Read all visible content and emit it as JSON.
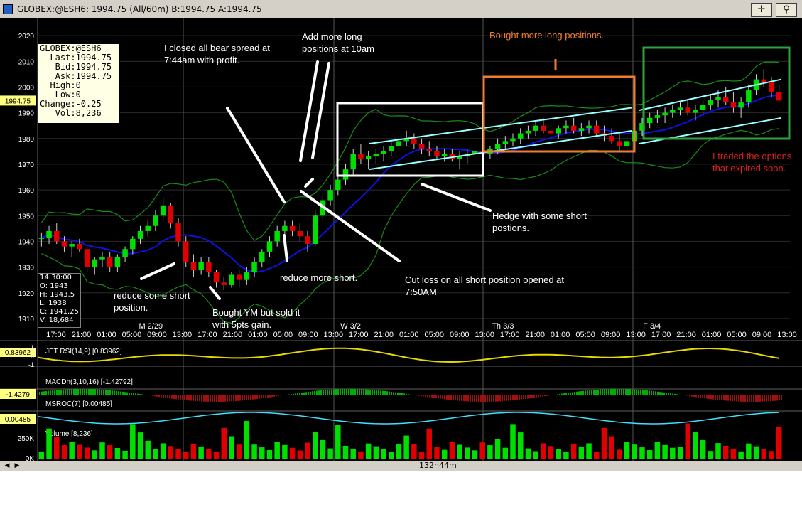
{
  "window": {
    "title": "GLOBEX:@ESH6: 1994.75 (All/60m)  B:1994.75  A:1994.75",
    "buttons": [
      "✛",
      "⚲"
    ]
  },
  "quote_box": {
    "rows": [
      "GLOBEX:@ESH6",
      "  Last:1994.75",
      "   Bid:1994.75",
      "   Ask:1994.75",
      "  High:0",
      "   Low:0",
      "Change:-0.25",
      "   Vol:8,236"
    ]
  },
  "bar_info": {
    "rows": [
      "14:30:00",
      "O: 1943",
      "H: 1943.5",
      "L: 1938",
      "C: 1941.25",
      "V: 18,684"
    ]
  },
  "price_marker": "1994.75",
  "annotations": [
    {
      "id": "closed-bear-spread",
      "lines": [
        "I closed all bear spread at",
        "7:44am with profit."
      ],
      "color": "#ffffff"
    },
    {
      "id": "add-long",
      "lines": [
        "Add more long",
        "positions at 10am"
      ],
      "color": "#ffffff"
    },
    {
      "id": "bought-more-long",
      "lines": [
        "Bought more long positions."
      ],
      "color": "#f07c30"
    },
    {
      "id": "traded-options",
      "lines": [
        "I traded the options",
        "that expired soon."
      ],
      "color": "#e02020"
    },
    {
      "id": "hedge-short",
      "lines": [
        "Hedge with some short",
        "postions."
      ],
      "color": "#ffffff"
    },
    {
      "id": "cut-loss",
      "lines": [
        "Cut loss on all short position opened at",
        "7:50AM"
      ],
      "color": "#ffffff"
    },
    {
      "id": "reduce-more-short",
      "lines": [
        "reduce more short."
      ],
      "color": "#ffffff"
    },
    {
      "id": "reduce-some-short",
      "lines": [
        "reduce some short",
        "position."
      ],
      "color": "#ffffff"
    },
    {
      "id": "bought-ym",
      "lines": [
        "Bought YM but sold it",
        "with 5pts gain."
      ],
      "color": "#ffffff"
    }
  ],
  "chart_data": {
    "type": "candlestick",
    "instrument": "GLOBEX:@ESH6",
    "interval": "60m",
    "price_axis": {
      "ticks": [
        2020,
        2010,
        2000,
        1990,
        1980,
        1970,
        1960,
        1950,
        1940,
        1930,
        1920,
        1910
      ],
      "ylim": [
        1905,
        2025
      ]
    },
    "time_labels": [
      "17:00",
      "21:00",
      "01:00",
      "05:00",
      "09:00",
      "13:00",
      "17:00",
      "21:00",
      "01:00",
      "05:00",
      "09:00",
      "13:00",
      "17:00",
      "21:00",
      "01:00",
      "05:00",
      "09:00",
      "13:00",
      "17:00",
      "21:00",
      "01:00",
      "05:00",
      "09:00",
      "13:00",
      "17:00",
      "21:00",
      "01:00",
      "05:00",
      "09:00",
      "13:00"
    ],
    "day_labels": [
      {
        "label": "M  2/29",
        "at": 3
      },
      {
        "label": "W  3/2",
        "at": 11
      },
      {
        "label": "Th 3/3",
        "at": 17
      },
      {
        "label": "F  3/4",
        "at": 23
      }
    ],
    "candles": [
      [
        1941,
        1943.5,
        1938,
        1941.25
      ],
      [
        1941.25,
        1946,
        1939,
        1944
      ],
      [
        1944,
        1947,
        1939,
        1940
      ],
      [
        1940,
        1942,
        1936,
        1938
      ],
      [
        1938,
        1940,
        1934,
        1939
      ],
      [
        1939,
        1941,
        1936,
        1937
      ],
      [
        1937,
        1938,
        1928,
        1930
      ],
      [
        1930,
        1934,
        1927,
        1933
      ],
      [
        1933,
        1936,
        1930,
        1934
      ],
      [
        1934,
        1936,
        1928,
        1930
      ],
      [
        1930,
        1935,
        1928,
        1934
      ],
      [
        1934,
        1938,
        1932,
        1937
      ],
      [
        1937,
        1942,
        1935,
        1941
      ],
      [
        1941,
        1946,
        1939,
        1944
      ],
      [
        1944,
        1948,
        1942,
        1946
      ],
      [
        1946,
        1952,
        1944,
        1950
      ],
      [
        1950,
        1957,
        1948,
        1954
      ],
      [
        1954,
        1955,
        1945,
        1947
      ],
      [
        1947,
        1949,
        1938,
        1940
      ],
      [
        1940,
        1942,
        1930,
        1932
      ],
      [
        1932,
        1935,
        1926,
        1929
      ],
      [
        1929,
        1934,
        1927,
        1932
      ],
      [
        1932,
        1934,
        1926,
        1928
      ],
      [
        1928,
        1929,
        1922,
        1924
      ],
      [
        1924,
        1926,
        1921,
        1923
      ],
      [
        1923,
        1928,
        1922,
        1927
      ],
      [
        1927,
        1929,
        1922,
        1925
      ],
      [
        1925,
        1930,
        1923,
        1928
      ],
      [
        1928,
        1934,
        1926,
        1932
      ],
      [
        1932,
        1937,
        1930,
        1936
      ],
      [
        1936,
        1942,
        1934,
        1940
      ],
      [
        1940,
        1946,
        1938,
        1944
      ],
      [
        1944,
        1948,
        1941,
        1946
      ],
      [
        1946,
        1948,
        1942,
        1944
      ],
      [
        1944,
        1947,
        1940,
        1942
      ],
      [
        1942,
        1944,
        1936,
        1939
      ],
      [
        1939,
        1952,
        1938,
        1950
      ],
      [
        1950,
        1958,
        1948,
        1956
      ],
      [
        1956,
        1962,
        1954,
        1960
      ],
      [
        1960,
        1966,
        1958,
        1964
      ],
      [
        1964,
        1970,
        1962,
        1968
      ],
      [
        1968,
        1976,
        1966,
        1974
      ],
      [
        1974,
        1978,
        1970,
        1972
      ],
      [
        1972,
        1975,
        1968,
        1973
      ],
      [
        1973,
        1976,
        1970,
        1974
      ],
      [
        1974,
        1977,
        1971,
        1975
      ],
      [
        1975,
        1979,
        1973,
        1977
      ],
      [
        1977,
        1981,
        1975,
        1979
      ],
      [
        1979,
        1983,
        1977,
        1980
      ],
      [
        1980,
        1982,
        1976,
        1978
      ],
      [
        1978,
        1980,
        1974,
        1976
      ],
      [
        1976,
        1979,
        1973,
        1975
      ],
      [
        1975,
        1977,
        1972,
        1973
      ],
      [
        1973,
        1976,
        1971,
        1974
      ],
      [
        1974,
        1976,
        1971,
        1972
      ],
      [
        1972,
        1975,
        1968,
        1973
      ],
      [
        1973,
        1976,
        1970,
        1974
      ],
      [
        1974,
        1977,
        1971,
        1975
      ],
      [
        1975,
        1978,
        1972,
        1974
      ],
      [
        1974,
        1977,
        1972,
        1976
      ],
      [
        1976,
        1980,
        1974,
        1978
      ],
      [
        1978,
        1981,
        1976,
        1979
      ],
      [
        1979,
        1982,
        1977,
        1980
      ],
      [
        1980,
        1984,
        1978,
        1982
      ],
      [
        1982,
        1985,
        1980,
        1983
      ],
      [
        1983,
        1987,
        1981,
        1985
      ],
      [
        1985,
        1988,
        1982,
        1983
      ],
      [
        1983,
        1986,
        1980,
        1982
      ],
      [
        1982,
        1985,
        1980,
        1984
      ],
      [
        1984,
        1987,
        1982,
        1985
      ],
      [
        1985,
        1988,
        1982,
        1983
      ],
      [
        1983,
        1986,
        1981,
        1984
      ],
      [
        1984,
        1987,
        1982,
        1985
      ],
      [
        1985,
        1987,
        1981,
        1982
      ],
      [
        1982,
        1985,
        1979,
        1981
      ],
      [
        1981,
        1984,
        1978,
        1979
      ],
      [
        1979,
        1982,
        1975,
        1977
      ],
      [
        1977,
        1981,
        1974,
        1979
      ],
      [
        1979,
        1984,
        1977,
        1983
      ],
      [
        1983,
        1988,
        1981,
        1986
      ],
      [
        1986,
        1990,
        1984,
        1988
      ],
      [
        1988,
        1991,
        1986,
        1989
      ],
      [
        1989,
        1992,
        1986,
        1990
      ],
      [
        1990,
        1993,
        1988,
        1991
      ],
      [
        1991,
        1994,
        1989,
        1992
      ],
      [
        1992,
        1995,
        1989,
        1990
      ],
      [
        1990,
        1993,
        1987,
        1991
      ],
      [
        1991,
        1995,
        1989,
        1993
      ],
      [
        1993,
        1997,
        1991,
        1995
      ],
      [
        1995,
        1999,
        1992,
        1996
      ],
      [
        1996,
        2000,
        1993,
        1994
      ],
      [
        1994,
        1998,
        1990,
        1992
      ],
      [
        1992,
        1996,
        1988,
        1994
      ],
      [
        1994,
        2001,
        1992,
        1999
      ],
      [
        1999,
        2005,
        1997,
        2003
      ],
      [
        2003,
        2007,
        2000,
        2002
      ],
      [
        2002,
        2004,
        1996,
        1998
      ],
      [
        1998,
        2001,
        1994,
        1994.75
      ]
    ],
    "indicators": [
      {
        "name": "JET RSI(14,9)",
        "value": "[0.83962]",
        "marker": "0.83962",
        "axis_ticks": [
          "1",
          "0",
          "-1"
        ]
      },
      {
        "name": "MACDh(3,10,16)",
        "value": "[-1.42792]",
        "marker": "-1.4279"
      },
      {
        "name": "MSROC(7)",
        "value": "[0.00485]",
        "marker": "0.00485"
      },
      {
        "name": "Volume",
        "value": "[8,236]",
        "axis_ticks": [
          "250K",
          "0K"
        ]
      }
    ]
  },
  "scrollbar": {
    "label": "132h44m"
  }
}
